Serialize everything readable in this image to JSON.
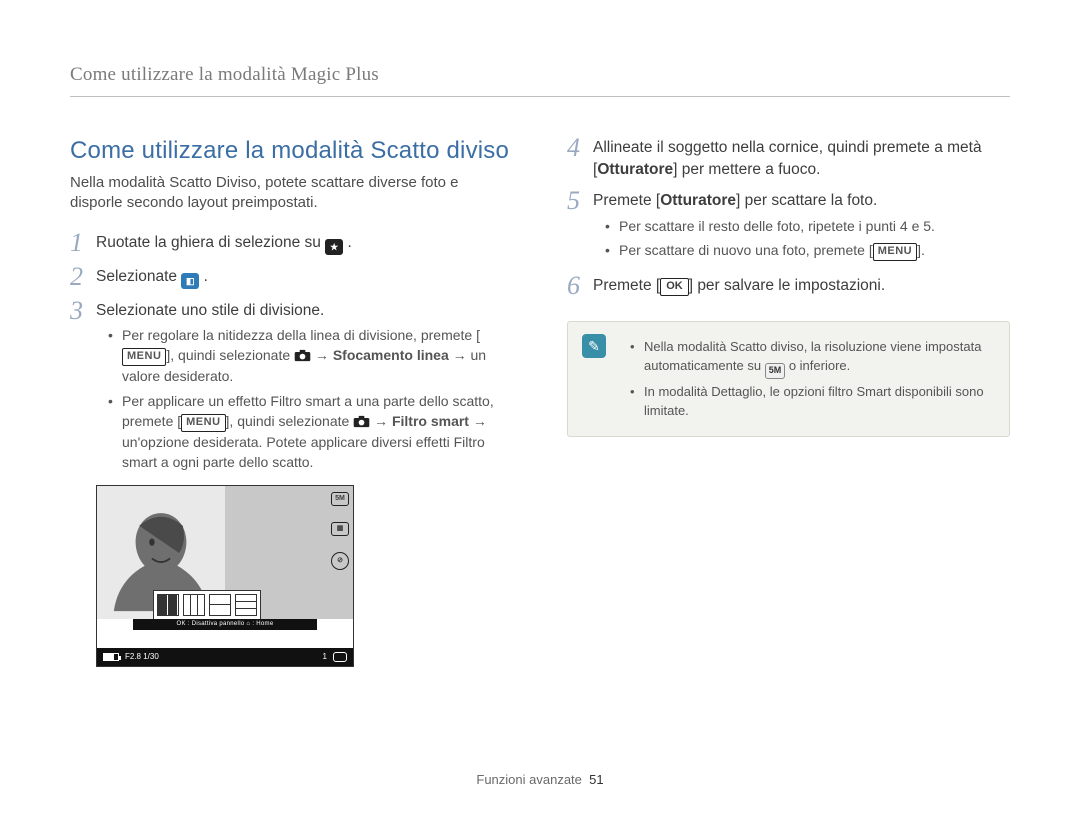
{
  "header": {
    "breadcrumb": "Come utilizzare la modalità Magic Plus"
  },
  "section": {
    "title": "Come utilizzare la modalità Scatto diviso",
    "intro": "Nella modalità Scatto Diviso, potete scattare diverse foto e disporle secondo layout preimpostati."
  },
  "steps": {
    "s1": {
      "num": "1",
      "pre": "Ruotate la ghiera di selezione su ",
      "post": " ."
    },
    "s2": {
      "num": "2",
      "pre": "Selezionate ",
      "post": " ."
    },
    "s3": {
      "num": "3",
      "text": "Selezionate uno stile di divisione.",
      "b1_pre": "Per regolare la nitidezza della linea di divisione, premete [",
      "b1_menu": "MENU",
      "b1_mid": "], quindi selezionate ",
      "b1_arrow": " → ",
      "b1_bold": "Sfocamento linea",
      "b1_post": " → un valore desiderato.",
      "b2_pre": "Per applicare un effetto Filtro smart a una parte dello scatto, premete [",
      "b2_menu": "MENU",
      "b2_mid": "], quindi selezionate ",
      "b2_arrow": " → ",
      "b2_bold": "Filtro smart",
      "b2_post": " → un'opzione desiderata. Potete applicare diversi effetti Filtro smart a ogni parte dello scatto."
    },
    "s4": {
      "num": "4",
      "pre": "Allineate il soggetto nella cornice, quindi premete a metà [",
      "bold": "Otturatore",
      "post": "] per mettere a fuoco."
    },
    "s5": {
      "num": "5",
      "pre": "Premete [",
      "bold": "Otturatore",
      "post": "] per scattare la foto.",
      "b1": "Per scattare il resto delle foto, ripetete i punti 4 e 5.",
      "b2_pre": "Per scattare di nuovo una foto, premete [",
      "b2_menu": "MENU",
      "b2_post": "]."
    },
    "s6": {
      "num": "6",
      "pre": "Premete [",
      "ok": "OK",
      "post": "] per salvare le impostazioni."
    }
  },
  "note": {
    "n1_pre": "Nella modalità Scatto diviso, la risoluzione viene impostata automaticamente su ",
    "n1_icon": "5M",
    "n1_post": " o inferiore.",
    "n2": "In modalità Dettaglio, le opzioni filtro Smart disponibili sono limitate."
  },
  "figure": {
    "hint": "OK : Disattiva pannello   ⌂ : Home",
    "exposure": "F2.8  1/30",
    "side1": "5M",
    "side2": "▦",
    "side3": "⊘",
    "count": "1"
  },
  "footer": {
    "label": "Funzioni avanzate",
    "page": "51"
  },
  "icons": {
    "mode_dial": "★",
    "split_mode": "◧",
    "camera": "camera",
    "note_glyph": "✎"
  }
}
